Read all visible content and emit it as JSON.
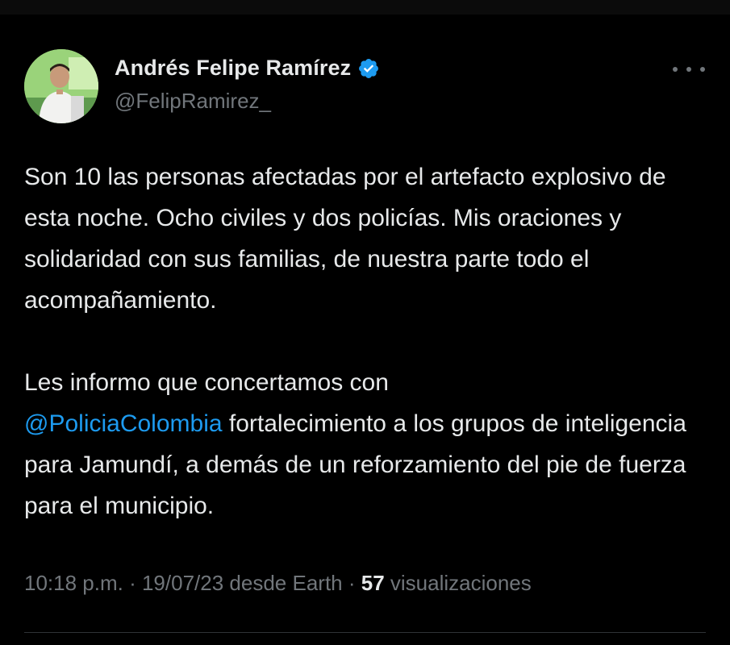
{
  "author": {
    "display_name": "Andrés Felipe Ramírez",
    "handle": "@FelipRamirez_",
    "verified": true,
    "verified_color": "#1d9bf0",
    "avatar_icon": "profile-photo"
  },
  "tweet": {
    "paragraph1": "Son 10 las personas afectadas por el artefacto explosivo de esta noche. Ocho civiles y dos policías. Mis oraciones y solidaridad con sus familias, de nuestra parte todo el acompañamiento.",
    "paragraph2_intro": "Les informo que concertamos con",
    "mention": "@PoliciaColombia",
    "paragraph2_rest": " fortalecimiento a los grupos de inteligencia para Jamundí, a demás de un reforzamiento del pie de fuerza para el municipio."
  },
  "meta": {
    "time": "10:18 p.m.",
    "date": "19/07/23",
    "source": "desde Earth",
    "separator": " · ",
    "views_count": "57",
    "views_label": "visualizaciones"
  },
  "icons": {
    "more": "more-horizontal-icon",
    "verified": "verified-badge-icon"
  },
  "colors": {
    "background": "#000000",
    "text": "#e7e9ea",
    "muted": "#71767b",
    "link": "#1d9bf0"
  }
}
